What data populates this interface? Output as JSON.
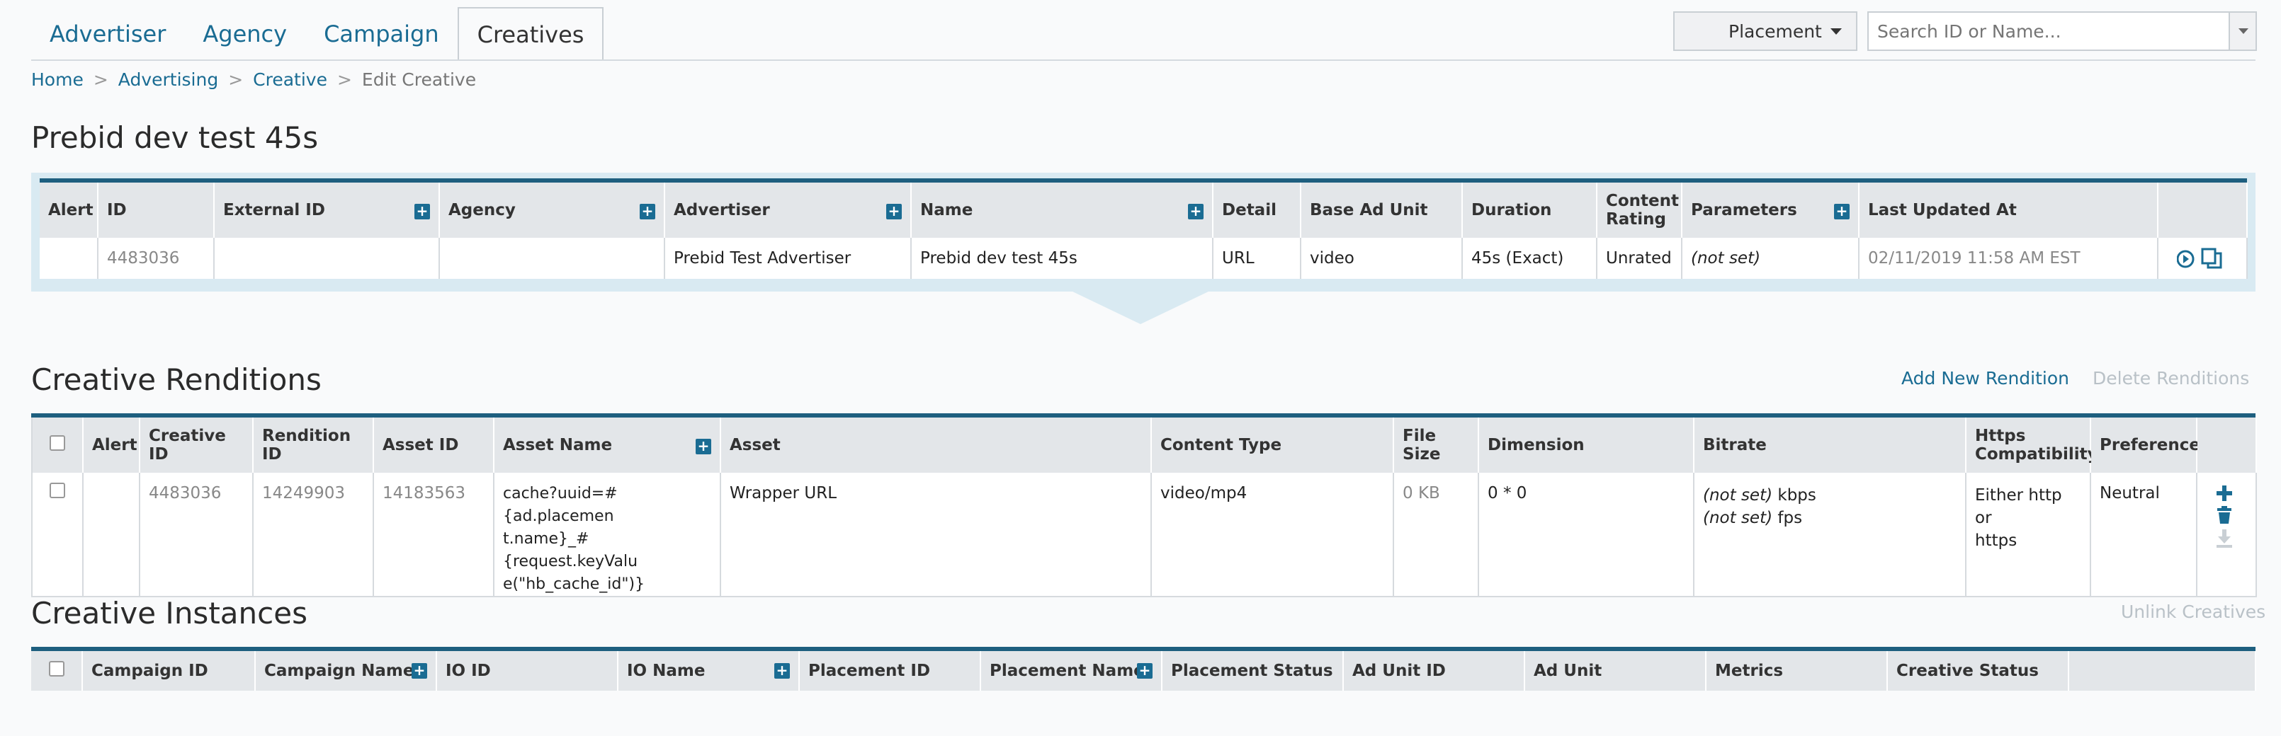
{
  "tabs": [
    "Advertiser",
    "Agency",
    "Campaign",
    "Creatives"
  ],
  "search": {
    "scope": "Placement",
    "placeholder": "Search ID or Name..."
  },
  "breadcrumb": [
    "Home",
    "Advertising",
    "Creative",
    "Edit Creative"
  ],
  "breadcrumb_sep": ">",
  "title": "Prebid dev test 45s",
  "creative_table": {
    "headers": [
      "Alert",
      "ID",
      "External ID",
      "Agency",
      "Advertiser",
      "Name",
      "Detail",
      "Base Ad Unit",
      "Duration",
      "Content Rating",
      "Parameters",
      "Last Updated At",
      ""
    ],
    "row": {
      "alert": "",
      "id": "4483036",
      "external_id": "",
      "agency": "",
      "advertiser": "Prebid Test Advertiser",
      "name": "Prebid dev test 45s",
      "detail": "URL",
      "base_ad_unit": "video",
      "duration": "45s (Exact)",
      "content_rating": "Unrated",
      "parameters": "(not set)",
      "last_updated": "02/11/2019 11:58 AM EST"
    }
  },
  "renditions": {
    "heading": "Creative Renditions",
    "add_label": "Add New Rendition",
    "delete_label": "Delete Renditions",
    "headers": [
      "Alert",
      "Creative ID",
      "Rendition ID",
      "Asset ID",
      "Asset Name",
      "Asset",
      "Content Type",
      "File Size",
      "Dimension",
      "Bitrate",
      "Https Compatibility",
      "Preference"
    ],
    "row": {
      "creative_id": "4483036",
      "rendition_id": "14249903",
      "asset_id": "14183563",
      "asset_name": "cache?uuid=#{ad.placement.name}_#{request.keyValue(\"hb_cache_id\")}",
      "asset_name_lines": [
        "cache?uuid=#{ad.placemen",
        "t.name}_#{request.keyValu",
        "e(\"hb_cache_id\")}"
      ],
      "asset": "Wrapper URL",
      "content_type": "video/mp4",
      "file_size": "0 KB",
      "dimension": "0 * 0",
      "bitrate_not_set": "(not set)",
      "bitrate_unit": "kbps",
      "fps_not_set": "(not set)",
      "fps_unit": "fps",
      "https": "Either http or https",
      "https_lines": [
        "Either http or",
        "https"
      ],
      "preference": "Neutral"
    }
  },
  "instances": {
    "heading": "Creative Instances",
    "unlink_label": "Unlink Creatives",
    "headers": [
      "Campaign ID",
      "Campaign Name",
      "IO ID",
      "IO Name",
      "Placement ID",
      "Placement Name",
      "Placement Status",
      "Ad Unit ID",
      "Ad Unit",
      "Metrics",
      "Creative Status"
    ]
  },
  "colors": {
    "link": "#1a6c93",
    "header_bar": "#1e5f7f",
    "panel": "#d9eaf2"
  }
}
